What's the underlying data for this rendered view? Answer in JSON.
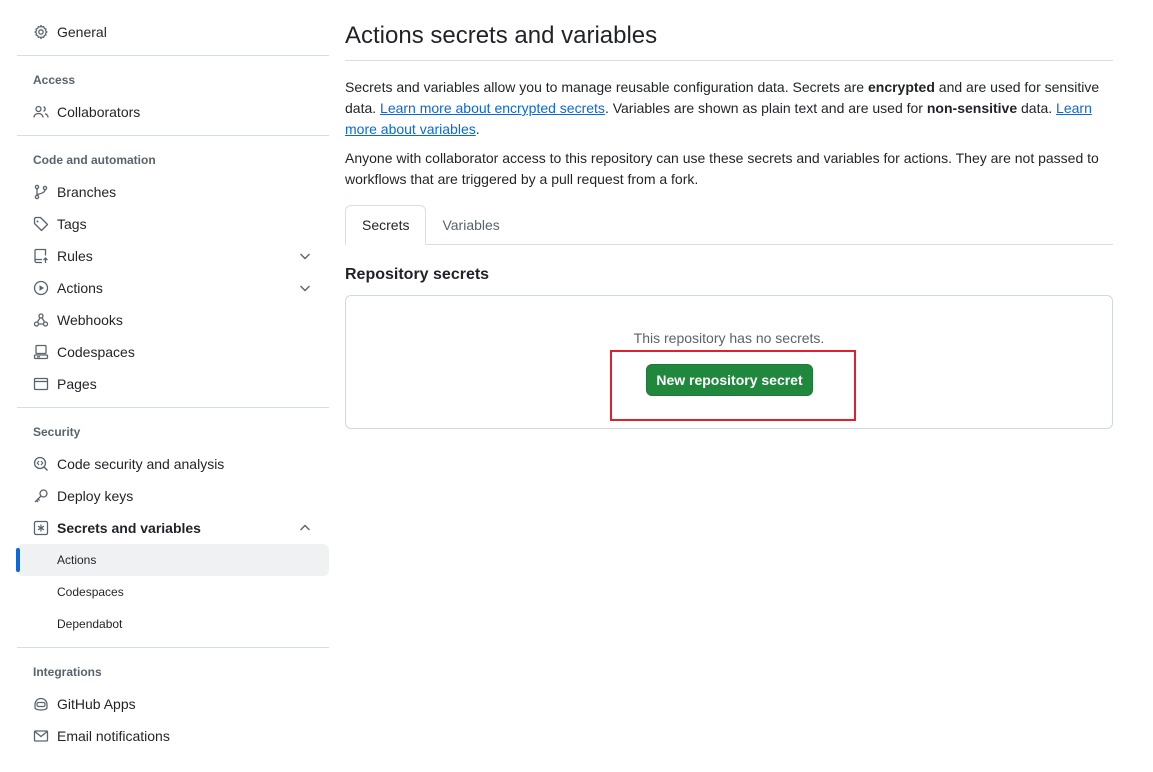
{
  "sidebar": {
    "general": "General",
    "access_title": "Access",
    "collaborators": "Collaborators",
    "code_title": "Code and automation",
    "branches": "Branches",
    "tags": "Tags",
    "rules": "Rules",
    "actions": "Actions",
    "webhooks": "Webhooks",
    "codespaces": "Codespaces",
    "pages": "Pages",
    "security_title": "Security",
    "code_security": "Code security and analysis",
    "deploy_keys": "Deploy keys",
    "secrets_vars": "Secrets and variables",
    "sub_actions": "Actions",
    "sub_codespaces": "Codespaces",
    "sub_dependabot": "Dependabot",
    "integrations_title": "Integrations",
    "github_apps": "GitHub Apps",
    "email_notifications": "Email notifications"
  },
  "main": {
    "title": "Actions secrets and variables",
    "p1_a": "Secrets and variables allow you to manage reusable configuration data. Secrets are ",
    "p1_b": "encrypted",
    "p1_c": " and are used for sensitive data. ",
    "p1_link1": "Learn more about encrypted secrets",
    "p1_d": ". Variables are shown as plain text and are used for ",
    "p1_e": "non-sensitive",
    "p1_f": " data. ",
    "p1_link2": "Learn more about variables",
    "p1_g": ".",
    "p2": "Anyone with collaborator access to this repository can use these secrets and variables for actions. They are not passed to workflows that are triggered by a pull request from a fork.",
    "tabs": [
      "Secrets",
      "Variables"
    ],
    "section_title": "Repository secrets",
    "empty_msg": "This repository has no secrets.",
    "new_secret_button": "New repository secret"
  },
  "colors": {
    "accent": "#0969da",
    "primary_button": "#1f883d",
    "highlight_box": "#e0202e"
  }
}
